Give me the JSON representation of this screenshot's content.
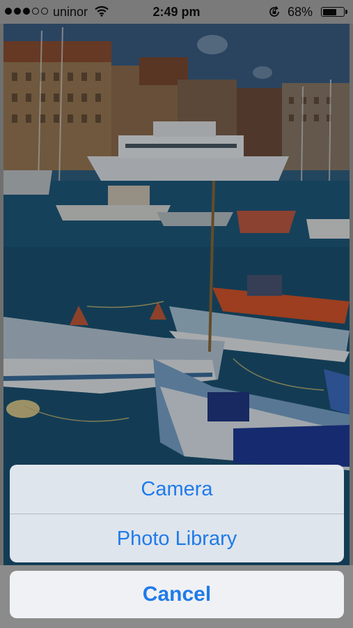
{
  "status_bar": {
    "carrier": "uninor",
    "time": "2:49 pm",
    "battery_percent": "68%",
    "battery_level": 0.68,
    "signal_strength": 3,
    "signal_max": 5,
    "icons": [
      "signal-icon",
      "wifi-icon",
      "rotation-lock-icon",
      "battery-icon"
    ]
  },
  "photo": {
    "subject": "harbor-boats-photo"
  },
  "action_sheet": {
    "options": [
      {
        "label": "Camera"
      },
      {
        "label": "Photo Library"
      }
    ],
    "cancel_label": "Cancel"
  },
  "colors": {
    "accent": "#1f7bea",
    "sheet_background": "#e8ecf2"
  }
}
